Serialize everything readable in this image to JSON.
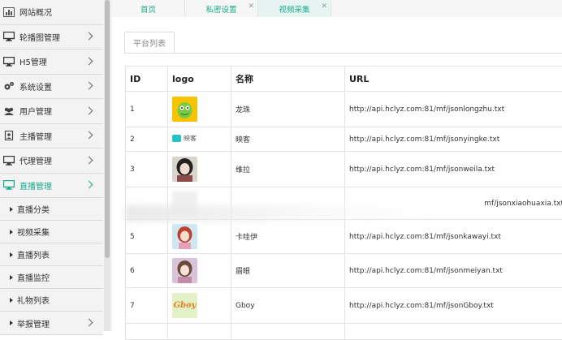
{
  "sidebar": {
    "items": [
      {
        "label": "网站概况",
        "icon": "bar-chart-icon",
        "has_arrow": false
      },
      {
        "label": "轮播图管理",
        "icon": "monitor-icon",
        "has_arrow": true
      },
      {
        "label": "H5管理",
        "icon": "monitor-icon",
        "has_arrow": true
      },
      {
        "label": "系统设置",
        "icon": "gears-icon",
        "has_arrow": true
      },
      {
        "label": "用户管理",
        "icon": "users-icon",
        "has_arrow": true
      },
      {
        "label": "主播管理",
        "icon": "id-card-icon",
        "has_arrow": true
      },
      {
        "label": "代理管理",
        "icon": "monitor-icon",
        "has_arrow": true
      },
      {
        "label": "直播管理",
        "icon": "monitor-icon",
        "has_arrow": true,
        "active": true
      }
    ],
    "subitems": [
      "直播分类",
      "视频采集",
      "直播列表",
      "直播监控",
      "礼物列表"
    ],
    "last_item": {
      "label": "举报管理",
      "has_arrow": true
    },
    "accent_color": "#1aaa8b"
  },
  "tabs": [
    {
      "label": "首页",
      "closable": false,
      "active": false
    },
    {
      "label": "私密设置",
      "closable": true,
      "active": false
    },
    {
      "label": "视频采集",
      "closable": true,
      "active": true
    }
  ],
  "close_glyph": "✕",
  "subtab": {
    "label": "平台列表"
  },
  "table": {
    "headers": [
      "ID",
      "logo",
      "名称",
      "URL"
    ],
    "rows": [
      {
        "id": "1",
        "logo": "green-dragon-logo",
        "name": "龙珠",
        "url": "http://api.hclyz.com:81/mf/jsonlongzhu.txt"
      },
      {
        "id": "2",
        "logo": "yingke-logo",
        "logo_text": "映客",
        "name": "映客",
        "url": "http://api.hclyz.com:81/mf/jsonyingke.txt"
      },
      {
        "id": "3",
        "logo": "portrait-logo",
        "name": "维拉",
        "url": "http://api.hclyz.com:81/mf/jsonweila.txt"
      },
      {
        "id": "",
        "logo": "blurred-logo",
        "name": "",
        "url": "mf/jsonxiaohuaxia.txt",
        "blurred": true
      },
      {
        "id": "5",
        "logo": "anime-girl-logo",
        "name": "卡哇伊",
        "url": "http://api.hclyz.com:81/mf/jsonkawayi.txt"
      },
      {
        "id": "6",
        "logo": "portrait-logo",
        "name": "眉眼",
        "url": "http://api.hclyz.com:81/mf/jsonmeiyan.txt"
      },
      {
        "id": "7",
        "logo": "gboy-logo",
        "logo_text": "Gboy",
        "name": "Gboy",
        "url": "http://api.hclyz.com:81/mf/jsonGboy.txt"
      }
    ]
  }
}
